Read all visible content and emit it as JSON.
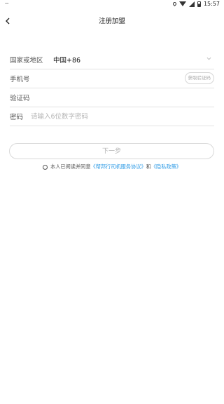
{
  "status_bar": {
    "left_glyph": "⌔",
    "time": "15:57"
  },
  "header": {
    "title": "注册加盟"
  },
  "form": {
    "country_label": "国家或地区",
    "country_value": "中国+86",
    "phone_label": "手机号",
    "phone_value": "",
    "get_code_label": "获取验证码",
    "code_label": "验证码",
    "code_value": "",
    "password_label": "密码",
    "password_placeholder": "请输入6位数字密码"
  },
  "next_label": "下一步",
  "agreement": {
    "prefix": "本人已阅读并同意",
    "service_link": "《帮邦行司机服务协议》",
    "conjunction": "和",
    "privacy_link": "《隐私政策》"
  }
}
